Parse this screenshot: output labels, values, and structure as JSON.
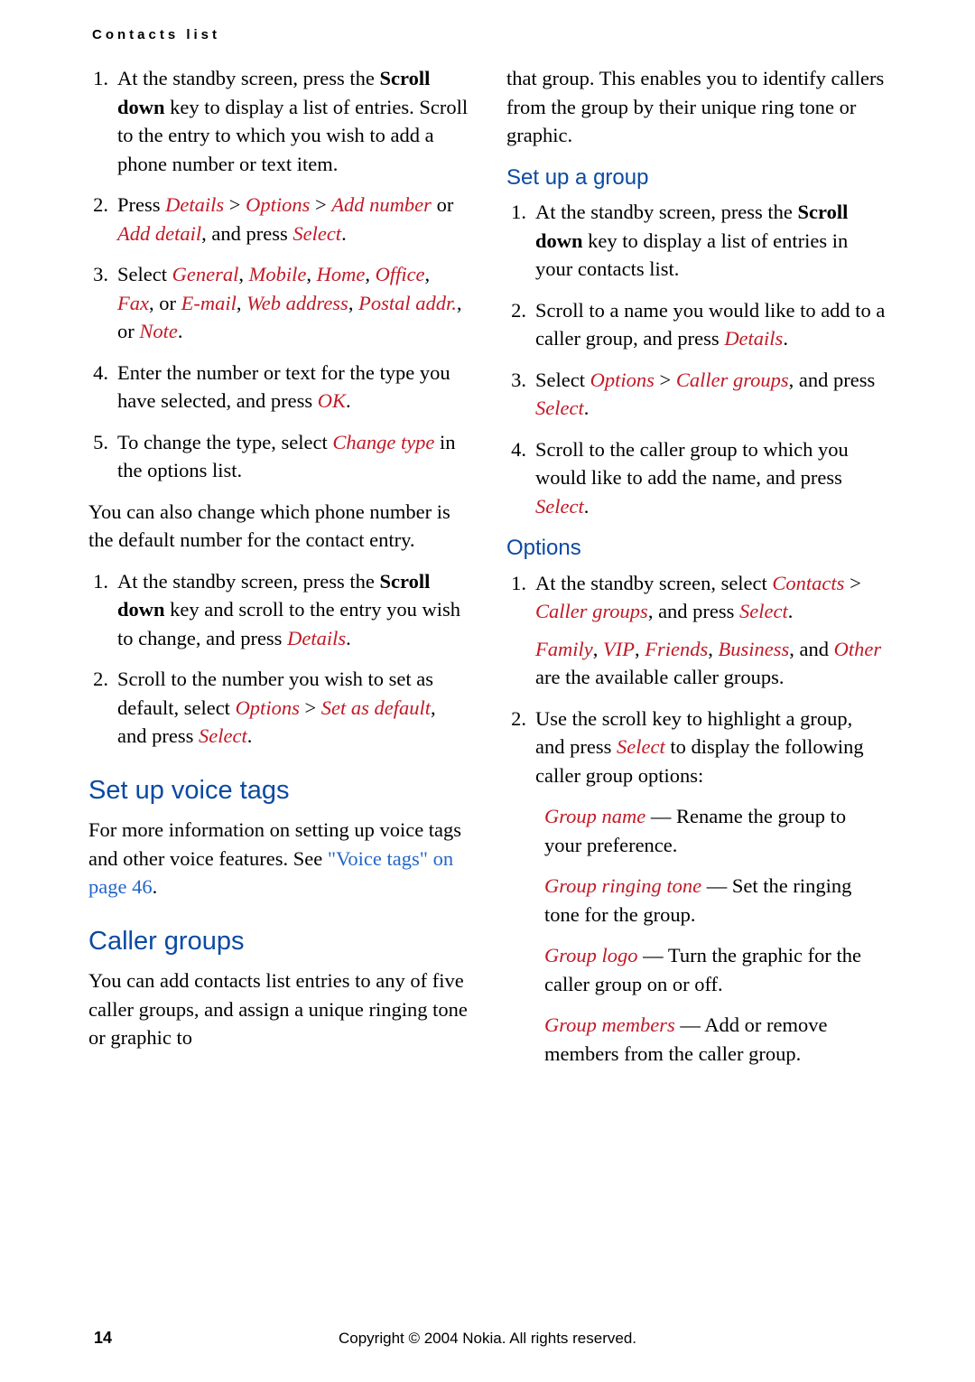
{
  "header": "Contacts list",
  "left": {
    "listA": [
      {
        "n": "1.",
        "pre": "At the standby screen, press the ",
        "b": "Scroll down",
        "post": " key to display a list of entries. Scroll to the entry to which you wish to add a phone number or text item."
      },
      {
        "n": "2.",
        "t": "li2"
      },
      {
        "n": "3.",
        "t": "li3"
      },
      {
        "n": "4.",
        "t": "li4"
      },
      {
        "n": "5.",
        "t": "li5"
      }
    ],
    "li2": {
      "a": "Press ",
      "c1": "Details",
      "s1": " > ",
      "c2": "Options",
      "s2": " > ",
      "c3": "Add number",
      "s3": " or ",
      "c4": "Add detail",
      "s4": ", and press ",
      "c5": "Select",
      "end": "."
    },
    "li3": {
      "a": "Select ",
      "c1": "General",
      "s1": ", ",
      "c2": "Mobile",
      "s2": ", ",
      "c3": "Home",
      "s3": ", ",
      "c4": "Office",
      "s4": ", ",
      "c5": "Fax",
      "s5": ", or ",
      "c6": "E-mail",
      "s6": ", ",
      "c7": "Web address",
      "s7": ", ",
      "c8": "Postal addr.",
      "s8": ", or ",
      "c9": "Note",
      "end": "."
    },
    "li4": {
      "a": "Enter the number or text for the type you have selected, and press ",
      "c1": "OK",
      "end": "."
    },
    "li5": {
      "a": "To change the type, select ",
      "c1": "Change type",
      "end": " in the options list."
    },
    "paraA": "You can also change which phone number is the default number for the contact entry.",
    "listB": [
      {
        "n": "1.",
        "t": "lb1"
      },
      {
        "n": "2.",
        "t": "lb2"
      }
    ],
    "lb1": {
      "a": "At the standby screen, press the ",
      "b": "Scroll down",
      "c": " key and scroll to the entry you wish to change, and press ",
      "c1": "Details",
      "end": "."
    },
    "lb2": {
      "a": "Scroll to the number you wish to set as default, select ",
      "c1": "Options",
      "s1": " > ",
      "c2": "Set as default",
      "s2": ", and press ",
      "c3": "Select",
      "end": "."
    },
    "secVoice": "Set up voice tags",
    "voicePara": {
      "a": "For more information on setting up voice tags and other voice features. See ",
      "link": "\"Voice tags\" on page 46",
      "end": "."
    },
    "secCaller": "Caller groups",
    "callerPara": "You can add contacts list entries to any of five caller groups, and assign a unique ringing tone or graphic to"
  },
  "right": {
    "contPara": "that group. This enables you to identify callers from the group by their unique ring tone or graphic.",
    "subSetup": "Set up a group",
    "listC": [
      {
        "n": "1.",
        "t": "lc1"
      },
      {
        "n": "2.",
        "t": "lc2"
      },
      {
        "n": "3.",
        "t": "lc3"
      },
      {
        "n": "4.",
        "t": "lc4"
      }
    ],
    "lc1": {
      "a": "At the standby screen, press the ",
      "b": "Scroll down",
      "c": " key to display a list of entries in your contacts list."
    },
    "lc2": {
      "a": "Scroll to a name you would like to add to a caller group, and press ",
      "c1": "Details",
      "end": "."
    },
    "lc3": {
      "a": "Select ",
      "c1": "Options",
      "s1": " > ",
      "c2": "Caller groups",
      "s2": ", and press ",
      "c3": "Select",
      "end": "."
    },
    "lc4": {
      "a": "Scroll to the caller group to which you would like to add the name, and press ",
      "c1": "Select",
      "end": "."
    },
    "subOptions": "Options",
    "listD": [
      {
        "n": "1.",
        "t": "ld1"
      },
      {
        "n": "2.",
        "t": "ld2"
      }
    ],
    "ld1": {
      "a": "At the standby screen, select ",
      "c1": "Contacts",
      "s1": " > ",
      "c2": "Caller groups",
      "s2": ", and press ",
      "c3": "Select",
      "end": "."
    },
    "ld1b": {
      "c1": "Family",
      "s1": ", ",
      "c2": "VIP",
      "s2": ", ",
      "c3": "Friends",
      "s3": ", ",
      "c4": "Business",
      "s4": ", and ",
      "c5": "Other",
      "end": " are the available caller groups."
    },
    "ld2": {
      "a": "Use the scroll key to highlight a group, and press ",
      "c1": "Select",
      "end": " to display the following caller group options:"
    },
    "opts": [
      {
        "c": "Group name",
        "t": " — Rename the group to your preference."
      },
      {
        "c": "Group ringing tone",
        "t": " — Set the ringing tone for the group."
      },
      {
        "c": "Group logo",
        "t": " — Turn the graphic for the caller group on or off."
      },
      {
        "c": "Group members",
        "t": " — Add or remove members from the caller group."
      }
    ]
  },
  "footer": {
    "page": "14",
    "copy": "Copyright © 2004 Nokia. All rights reserved."
  }
}
